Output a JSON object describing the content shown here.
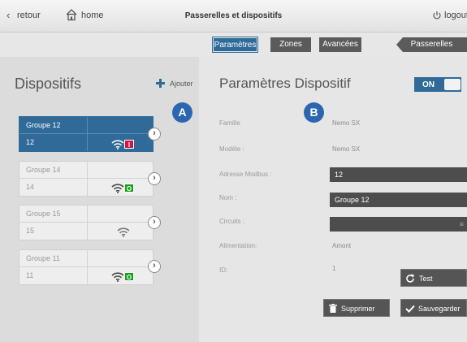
{
  "topbar": {
    "back_label": "retour",
    "home_label": "home",
    "title": "Passerelles et dispositifs",
    "logout_label": "logout"
  },
  "tabs": [
    {
      "label": "Paramètres",
      "active": true
    },
    {
      "label": "Zones",
      "active": false
    },
    {
      "label": "Avancées",
      "active": false
    },
    {
      "label": "Passerelles",
      "active": false
    }
  ],
  "left": {
    "title": "Dispositifs",
    "add_label": "Ajouter",
    "devices": [
      {
        "name": "Groupe 12",
        "number": "12",
        "status": "I",
        "status_color": "#d0163f",
        "selected": true
      },
      {
        "name": "Groupe 14",
        "number": "14",
        "status": "O",
        "status_color": "#17a017",
        "selected": false
      },
      {
        "name": "Groupe 15",
        "number": "15",
        "status": "",
        "status_color": "",
        "selected": false
      },
      {
        "name": "Groupe 11",
        "number": "11",
        "status": "O",
        "status_color": "#17a017",
        "selected": false
      }
    ]
  },
  "markers": {
    "a": "A",
    "b": "B"
  },
  "right": {
    "title": "Paramètres Dispositif",
    "toggle_label": "ON",
    "fields": {
      "famille_label": "Famille",
      "famille_value": "Nemo SX",
      "modele_label": "Modèle :",
      "modele_value": "Nemo SX",
      "modbus_label": "Adresse Modbus :",
      "modbus_value": "12",
      "nom_label": "Nom :",
      "nom_value": "Groupe 12",
      "circuits_label": "Circuits :",
      "circuits_value": "",
      "alimentation_label": "Alimentation:",
      "alimentation_value": "Amont",
      "id_label": "ID:",
      "id_value": "1"
    },
    "test_label": "Test",
    "delete_label": "Supprimer",
    "save_label": "Sauvegarder"
  },
  "colors": {
    "accent": "#2f6a98",
    "marker": "#2d66b0"
  }
}
